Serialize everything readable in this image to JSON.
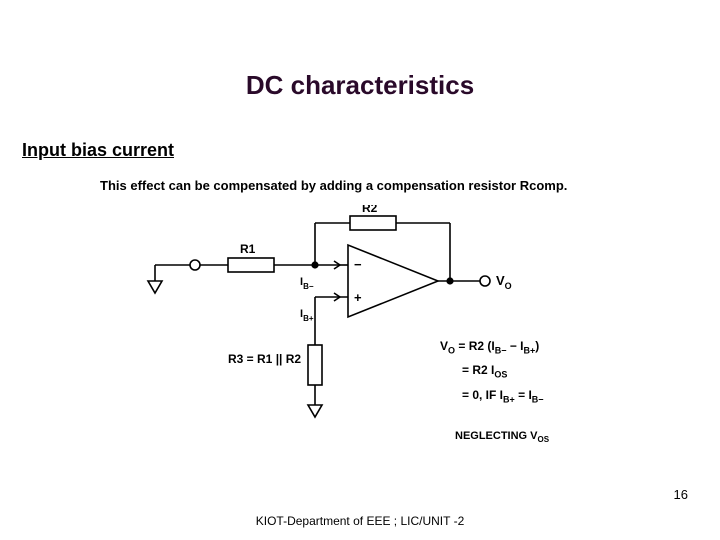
{
  "title": "DC characteristics",
  "subheading": "Input bias current",
  "desc": "This effect can be compensated by adding a compensation resistor Rcomp.",
  "labels": {
    "r1": "R1",
    "r2": "R2",
    "r3": "R3 = R1 || R2",
    "ibm": "I",
    "ibm_sub": "B−",
    "ibp": "I",
    "ibp_sub": "B+",
    "minus": "−",
    "plus": "+",
    "vo": "V",
    "vo_sub": "O"
  },
  "eq1_pre": "V",
  "eq1_osub": "O",
  "eq1_mid": " = R2 (I",
  "eq1_bm": "B−",
  "eq1_sep": " − I",
  "eq1_bp": "B+",
  "eq1_end": ")",
  "eq2_pre": "= R2 I",
  "eq2_sub": "OS",
  "eq3_pre": "= 0, IF I",
  "eq3_bp": "B+",
  "eq3_mid": " = I",
  "eq3_bm": "B−",
  "neglect_pre": "NEGLECTING V",
  "neglect_sub": "OS",
  "pagenum": "16",
  "footer": "KIOT-Department of EEE ; LIC/UNIT -2"
}
